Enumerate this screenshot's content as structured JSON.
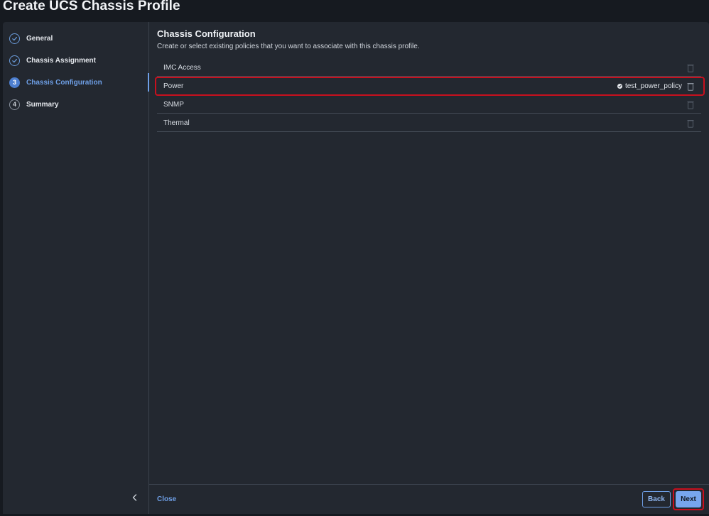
{
  "page": {
    "title": "Create UCS Chassis Profile"
  },
  "wizard": {
    "steps": [
      {
        "number": "1",
        "label": "General",
        "state": "done"
      },
      {
        "number": "2",
        "label": "Chassis Assignment",
        "state": "done"
      },
      {
        "number": "3",
        "label": "Chassis Configuration",
        "state": "current"
      },
      {
        "number": "4",
        "label": "Summary",
        "state": "pending"
      }
    ],
    "collapse_icon": "chevron-left-icon"
  },
  "main": {
    "title": "Chassis Configuration",
    "subtitle": "Create or select existing policies that you want to associate with this chassis profile.",
    "policies": [
      {
        "label": "IMC Access",
        "value": ""
      },
      {
        "label": "Power",
        "value": "test_power_policy",
        "highlighted": true
      },
      {
        "label": "SNMP",
        "value": ""
      },
      {
        "label": "Thermal",
        "value": ""
      }
    ]
  },
  "footer": {
    "close_label": "Close",
    "back_label": "Back",
    "next_label": "Next"
  },
  "colors": {
    "accent": "#6e9fe6",
    "highlight": "#c8101e",
    "background": "#232830"
  }
}
